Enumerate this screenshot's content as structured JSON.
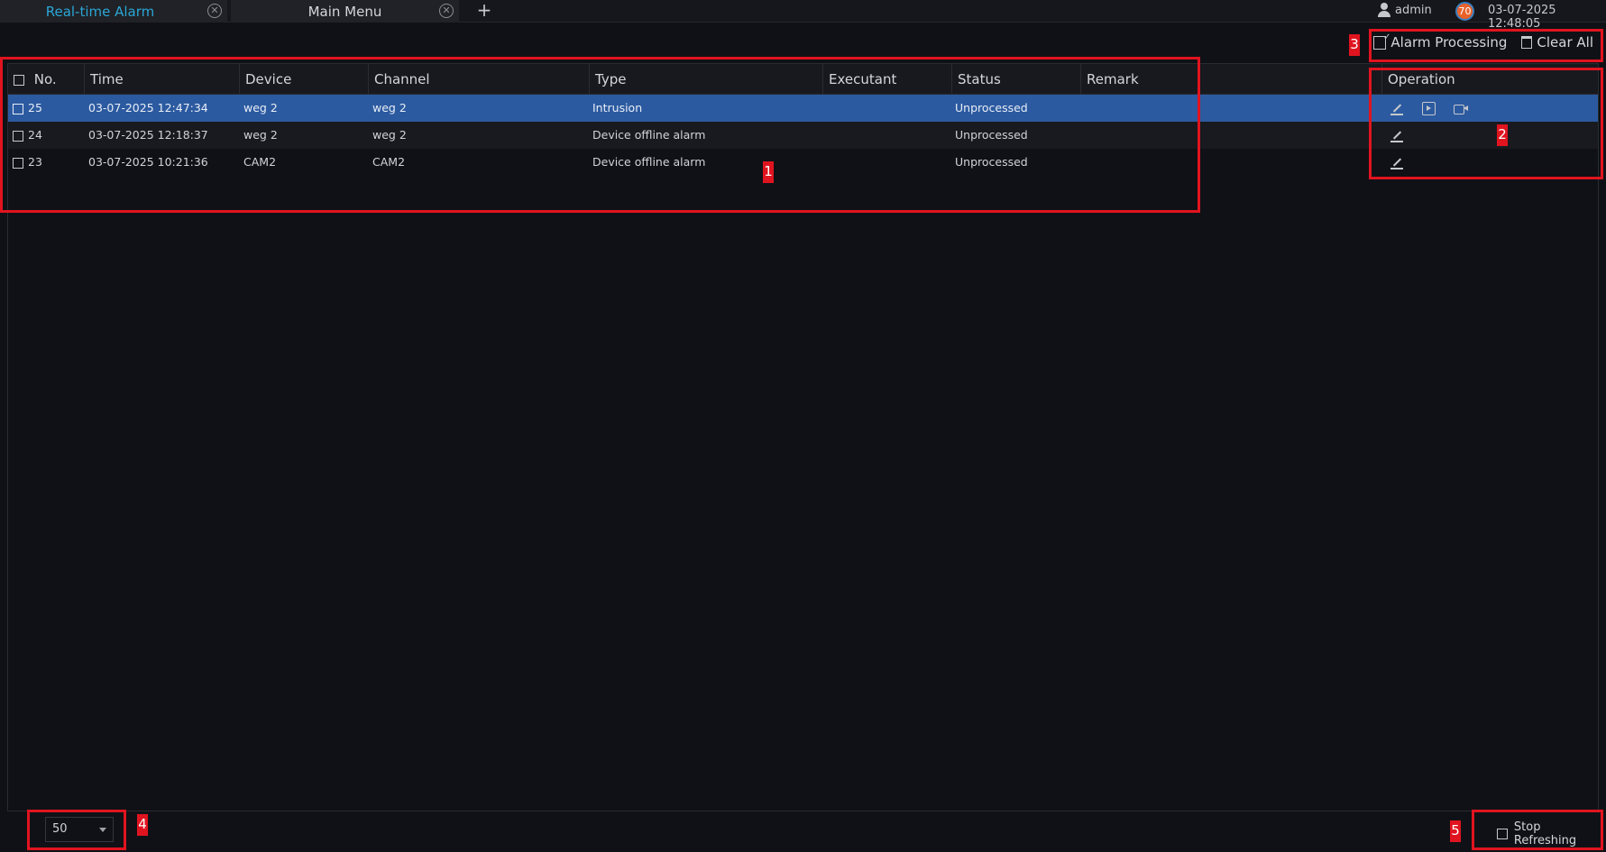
{
  "tabs": [
    {
      "label": "Real-time Alarm"
    },
    {
      "label": "Main Menu"
    }
  ],
  "tab_add_label": "+",
  "tab_close_glyph": "✕",
  "user": {
    "name": "admin"
  },
  "notification_count": "70",
  "datetime": "03-07-2025 12:48:05",
  "toolbar": {
    "alarm_processing": "Alarm Processing",
    "clear_all": "Clear All"
  },
  "table": {
    "headers": {
      "no": "No.",
      "time": "Time",
      "device": "Device",
      "channel": "Channel",
      "type": "Type",
      "executant": "Executant",
      "status": "Status",
      "remark": "Remark",
      "operation": "Operation"
    },
    "rows": [
      {
        "no": "25",
        "time": "03-07-2025 12:47:34",
        "device": "weg 2",
        "channel": "weg 2",
        "type": "Intrusion",
        "executant": "",
        "status": "Unprocessed",
        "remark": "",
        "operations": [
          "edit-icon",
          "playback-icon",
          "live-video-icon"
        ],
        "selected": true
      },
      {
        "no": "24",
        "time": "03-07-2025 12:18:37",
        "device": "weg 2",
        "channel": "weg 2",
        "type": "Device offline alarm",
        "executant": "",
        "status": "Unprocessed",
        "remark": "",
        "operations": [
          "edit-icon"
        ],
        "selected": false
      },
      {
        "no": "23",
        "time": "03-07-2025 10:21:36",
        "device": "CAM2",
        "channel": "CAM2",
        "type": "Device offline alarm",
        "executant": "",
        "status": "Unprocessed",
        "remark": "",
        "operations": [
          "edit-icon"
        ],
        "selected": false
      }
    ]
  },
  "footer": {
    "page_size": "50",
    "stop_refreshing": "Stop Refreshing"
  },
  "annotations": [
    "1",
    "2",
    "3",
    "4",
    "5"
  ],
  "colors": {
    "accent_tab": "#2aa6d6",
    "selected_row": "#2c5aa0",
    "annotation": "#e0141f",
    "badge": "#e9622a"
  }
}
